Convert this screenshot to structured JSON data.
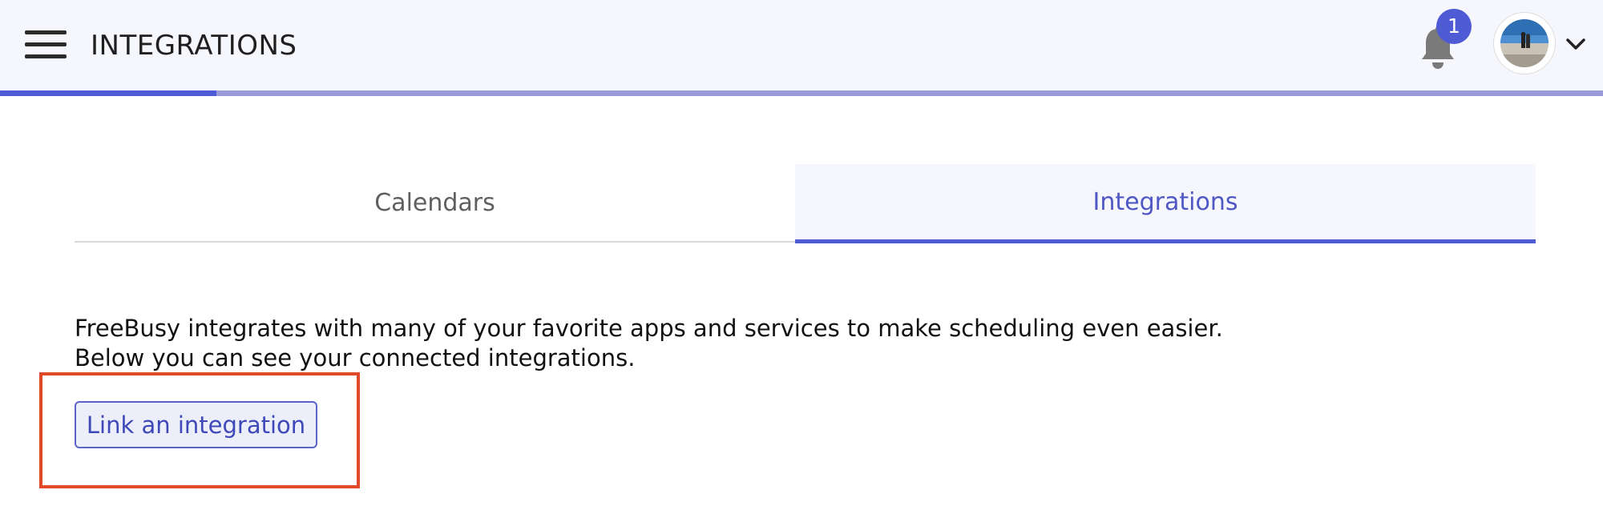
{
  "header": {
    "title": "INTEGRATIONS",
    "menu_icon": "hamburger-menu-icon",
    "notification_icon": "bell-icon",
    "notification_count": "1",
    "avatar_icon": "user-avatar",
    "dropdown_icon": "chevron-down-icon",
    "progress_fraction": 0.135
  },
  "tabs": [
    {
      "label": "Calendars",
      "active": false
    },
    {
      "label": "Integrations",
      "active": true
    }
  ],
  "main": {
    "description_line1": "FreeBusy integrates with many of your favorite apps and services to make scheduling even easier.",
    "description_line2": "Below you can see your connected integrations.",
    "link_button_label": "Link an integration"
  },
  "colors": {
    "accent": "#4f5bd5",
    "highlight_box": "#e04a2b",
    "header_bg": "#f6f7fc"
  }
}
